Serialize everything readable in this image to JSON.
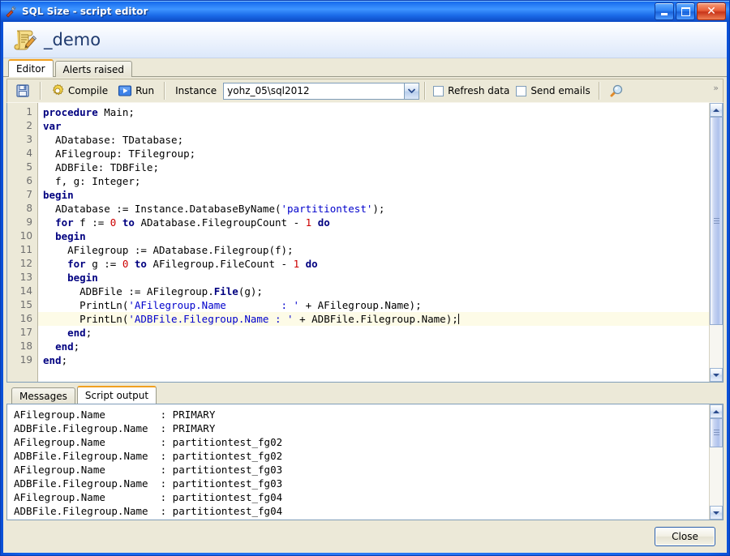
{
  "window": {
    "title": "SQL Size - script editor",
    "icon": "wrench-icon",
    "minimize_label": "Minimize",
    "maximize_label": "Maximize",
    "close_label": "Close"
  },
  "header": {
    "icon": "script-edit-icon",
    "title": "_demo"
  },
  "tabs": [
    {
      "label": "Editor",
      "active": true
    },
    {
      "label": "Alerts raised",
      "active": false
    }
  ],
  "toolbar": {
    "save_label": "",
    "save_icon": "save-floppy-icon",
    "compile_label": "Compile",
    "compile_icon": "gear-icon",
    "run_label": "Run",
    "run_icon": "play-icon",
    "instance_label": "Instance",
    "instance_value": "yohz_05\\sql2012",
    "refresh_label": "Refresh data",
    "refresh_checked": false,
    "emails_label": "Send emails",
    "emails_checked": false,
    "search_icon": "magnifier-icon",
    "overflow_label": "»"
  },
  "editor": {
    "current_line": 16,
    "line_numbers": [
      1,
      2,
      3,
      4,
      5,
      6,
      7,
      8,
      9,
      10,
      11,
      12,
      13,
      14,
      15,
      16,
      17,
      18,
      19
    ],
    "lines": [
      "procedure Main;",
      "var",
      "  ADatabase: TDatabase;",
      "  AFilegroup: TFilegroup;",
      "  ADBFile: TDBFile;",
      "  f, g: Integer;",
      "begin",
      "  ADatabase := Instance.DatabaseByName('partitiontest');",
      "  for f := 0 to ADatabase.FilegroupCount - 1 do",
      "  begin",
      "    AFilegroup := ADatabase.Filegroup(f);",
      "    for g := 0 to AFilegroup.FileCount - 1 do",
      "    begin",
      "      ADBFile := AFilegroup.File(g);",
      "      PrintLn('AFilegroup.Name         : ' + AFilegroup.Name);",
      "      PrintLn('ADBFile.Filegroup.Name : ' + ADBFile.Filegroup.Name);",
      "    end;",
      "  end;",
      "end;"
    ]
  },
  "bottom_tabs": [
    {
      "label": "Messages",
      "active": false
    },
    {
      "label": "Script output",
      "active": true
    }
  ],
  "output": {
    "lines": [
      "AFilegroup.Name         : PRIMARY",
      "ADBFile.Filegroup.Name  : PRIMARY",
      "AFilegroup.Name         : partitiontest_fg02",
      "ADBFile.Filegroup.Name  : partitiontest_fg02",
      "AFilegroup.Name         : partitiontest_fg03",
      "ADBFile.Filegroup.Name  : partitiontest_fg03",
      "AFilegroup.Name         : partitiontest_fg04",
      "ADBFile.Filegroup.Name  : partitiontest_fg04"
    ]
  },
  "footer": {
    "close_label": "Close"
  },
  "colors": {
    "accent_orange": "#F0A020",
    "titlebar_blue": "#2C7BF5",
    "face": "#ECE9D8",
    "keyword": "#000080",
    "string": "#0000CC",
    "number": "#CC0000",
    "current_line": "#FDFBE7"
  }
}
